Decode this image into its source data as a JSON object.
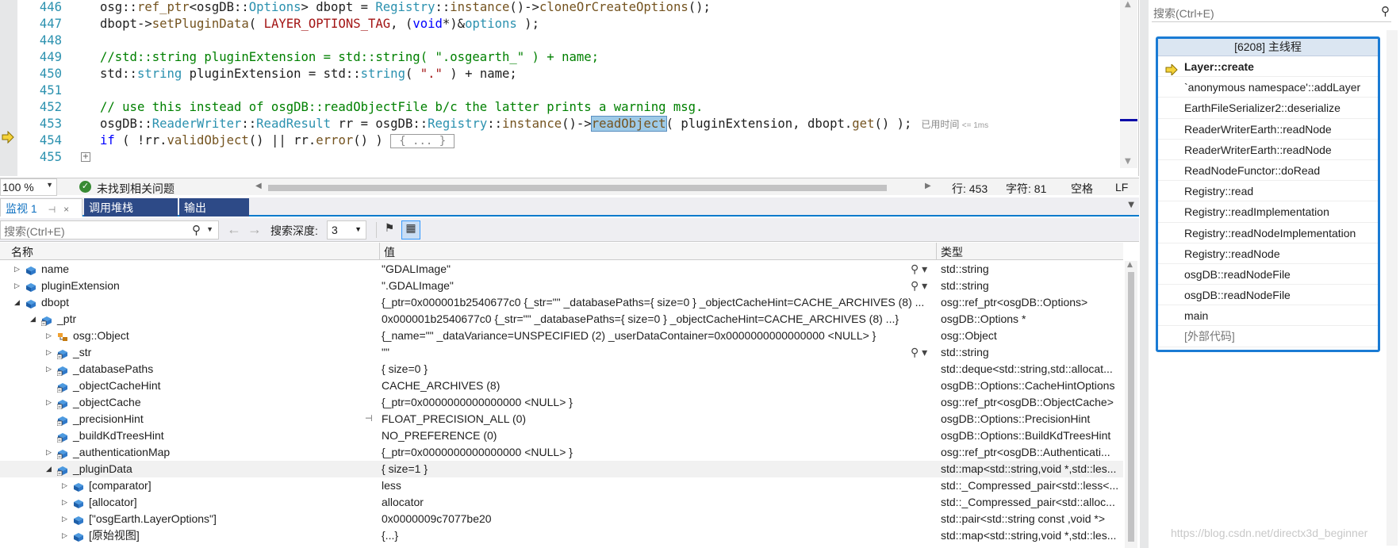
{
  "editor": {
    "lines": [
      {
        "num": "446",
        "tokens": [
          [
            "",
            "osg::"
          ],
          [
            "f",
            "ref_ptr"
          ],
          [
            "",
            "<osgDB::"
          ],
          [
            "t",
            "Options"
          ],
          [
            "",
            "> dbopt = "
          ],
          [
            "t",
            "Registry"
          ],
          [
            "",
            "::"
          ],
          [
            "f",
            "instance"
          ],
          [
            "",
            "()->"
          ],
          [
            "f",
            "cloneOrCreateOptions"
          ],
          [
            "",
            "();"
          ]
        ]
      },
      {
        "num": "447",
        "tokens": [
          [
            "",
            "dbopt->"
          ],
          [
            "f",
            "setPluginData"
          ],
          [
            "",
            "( "
          ],
          [
            "s",
            "LAYER_OPTIONS_TAG"
          ],
          [
            "",
            ", ("
          ],
          [
            "k",
            "void"
          ],
          [
            "",
            "*)&"
          ],
          [
            "t",
            "options"
          ],
          [
            "",
            " );"
          ]
        ]
      },
      {
        "num": "448",
        "tokens": []
      },
      {
        "num": "449",
        "tokens": [
          [
            "c",
            "//std::string pluginExtension = std::string( \".osgearth_\" ) + name;"
          ]
        ]
      },
      {
        "num": "450",
        "tokens": [
          [
            "",
            "std::"
          ],
          [
            "t",
            "string"
          ],
          [
            "",
            " pluginExtension = std::"
          ],
          [
            "t",
            "string"
          ],
          [
            "",
            "( "
          ],
          [
            "s",
            "\".\""
          ],
          [
            "",
            " ) + name;"
          ]
        ]
      },
      {
        "num": "451",
        "tokens": []
      },
      {
        "num": "452",
        "tokens": [
          [
            "c",
            "// use this instead of osgDB::readObjectFile b/c the latter prints a warning msg."
          ]
        ]
      },
      {
        "num": "453",
        "tokens": [
          [
            "",
            "osgDB::"
          ],
          [
            "t",
            "ReaderWriter"
          ],
          [
            "",
            "::"
          ],
          [
            "t",
            "ReadResult"
          ],
          [
            "",
            " rr = osgDB::"
          ],
          [
            "t",
            "Registry"
          ],
          [
            "",
            "::"
          ],
          [
            "f",
            "instance"
          ],
          [
            "",
            "()->"
          ],
          [
            "hl",
            "readObject"
          ],
          [
            "",
            "( pluginExtension, dbopt."
          ],
          [
            "f",
            "get"
          ],
          [
            "",
            "() );"
          ]
        ],
        "elapsed": "已用时间",
        "elapsed_small": "<= 1ms"
      },
      {
        "num": "454",
        "tokens": [
          [
            "k",
            "if"
          ],
          [
            "",
            " ( !rr."
          ],
          [
            "f",
            "validObject"
          ],
          [
            "",
            "() || rr."
          ],
          [
            "f",
            "error"
          ],
          [
            "",
            "() )"
          ]
        ],
        "fold": "{ ... }"
      },
      {
        "num": "455",
        "tokens": []
      }
    ]
  },
  "status": {
    "zoom": "100 %",
    "ok_text": "未找到相关问题",
    "line": "行: 453",
    "char": "字符: 81",
    "ws": "空格",
    "eol": "LF"
  },
  "tabs": [
    "监视 1",
    "调用堆栈",
    "输出"
  ],
  "watch": {
    "search_placeholder": "搜索(Ctrl+E)",
    "depth_label": "搜索深度:",
    "depth_value": "3",
    "col_name": "名称",
    "col_value": "值",
    "col_type": "类型",
    "rows": [
      {
        "indent": 0,
        "exp": "▷",
        "icon": "field-icon",
        "name": "name",
        "value": "\"GDALImage\"",
        "type": "std::string",
        "mag": true
      },
      {
        "indent": 0,
        "exp": "▷",
        "icon": "field-icon",
        "name": "pluginExtension",
        "value": "\".GDALImage\"",
        "type": "std::string",
        "mag": true
      },
      {
        "indent": 0,
        "exp": "◢",
        "icon": "field-icon",
        "name": "dbopt",
        "value": "{_ptr=0x000001b2540677c0 {_str=\"\" _databasePaths={ size=0 } _objectCacheHint=CACHE_ARCHIVES (8) ...",
        "type": "osg::ref_ptr<osgDB::Options>"
      },
      {
        "indent": 1,
        "exp": "◢",
        "icon": "protected-field-icon",
        "name": "_ptr",
        "value": "0x000001b2540677c0 {_str=\"\" _databasePaths={ size=0 } _objectCacheHint=CACHE_ARCHIVES (8) ...}",
        "type": "osgDB::Options *"
      },
      {
        "indent": 2,
        "exp": "▷",
        "icon": "base-class-icon",
        "name": "osg::Object",
        "value": "{_name=\"\" _dataVariance=UNSPECIFIED (2) _userDataContainer=0x0000000000000000 <NULL> }",
        "type": "osg::Object"
      },
      {
        "indent": 2,
        "exp": "▷",
        "icon": "protected-field-icon",
        "name": "_str",
        "value": "\"\"",
        "type": "std::string",
        "mag": true
      },
      {
        "indent": 2,
        "exp": "▷",
        "icon": "protected-field-icon",
        "name": "_databasePaths",
        "value": "{ size=0 }",
        "type": "std::deque<std::string,std::allocat..."
      },
      {
        "indent": 2,
        "exp": "",
        "icon": "protected-field-icon",
        "name": "_objectCacheHint",
        "value": "CACHE_ARCHIVES (8)",
        "type": "osgDB::Options::CacheHintOptions"
      },
      {
        "indent": 2,
        "exp": "▷",
        "icon": "protected-field-icon",
        "name": "_objectCache",
        "value": "{_ptr=0x0000000000000000 <NULL> }",
        "type": "osg::ref_ptr<osgDB::ObjectCache>"
      },
      {
        "indent": 2,
        "exp": "",
        "icon": "protected-field-icon",
        "name": "_precisionHint",
        "value": "FLOAT_PRECISION_ALL (0)",
        "type": "osgDB::Options::PrecisionHint",
        "pin": true
      },
      {
        "indent": 2,
        "exp": "",
        "icon": "protected-field-icon",
        "name": "_buildKdTreesHint",
        "value": "NO_PREFERENCE (0)",
        "type": "osgDB::Options::BuildKdTreesHint"
      },
      {
        "indent": 2,
        "exp": "▷",
        "icon": "protected-field-icon",
        "name": "_authenticationMap",
        "value": "{_ptr=0x0000000000000000 <NULL> }",
        "type": "osg::ref_ptr<osgDB::Authenticati..."
      },
      {
        "indent": 2,
        "exp": "◢",
        "icon": "protected-field-icon",
        "name": "_pluginData",
        "value": "{ size=1 }",
        "type": "std::map<std::string,void *,std::les...",
        "sel": true
      },
      {
        "indent": 3,
        "exp": "▷",
        "icon": "field-icon",
        "name": "[comparator]",
        "value": "less",
        "type": "std::_Compressed_pair<std::less<..."
      },
      {
        "indent": 3,
        "exp": "▷",
        "icon": "field-icon",
        "name": "[allocator]",
        "value": "allocator",
        "type": "std::_Compressed_pair<std::alloc..."
      },
      {
        "indent": 3,
        "exp": "▷",
        "icon": "field-icon",
        "name": "[\"osgEarth.LayerOptions\"]",
        "value": "0x0000009c7077be20",
        "type": "std::pair<std::string const ,void *>"
      },
      {
        "indent": 3,
        "exp": "▷",
        "icon": "field-icon",
        "name": "[原始视图]",
        "value": "{...}",
        "type": "std::map<std::string,void *,std::les..."
      }
    ]
  },
  "callstack": {
    "search_placeholder": "搜索(Ctrl+E)",
    "thread": "[6208] 主线程",
    "frames": [
      "Layer::create",
      "`anonymous namespace'::addLayer",
      "EarthFileSerializer2::deserialize",
      "ReaderWriterEarth::readNode",
      "ReaderWriterEarth::readNode",
      "ReadNodeFunctor::doRead",
      "Registry::read",
      "Registry::readImplementation",
      "Registry::readNodeImplementation",
      "Registry::readNode",
      "osgDB::readNodeFile",
      "osgDB::readNodeFile",
      "main",
      "[外部代码]"
    ]
  },
  "watermark": "https://blog.csdn.net/directx3d_beginner",
  "colors": {
    "accent": "#007acc",
    "tab_inactive": "#2d4a87",
    "frame_border": "#1a7bd4",
    "comment": "#008000",
    "keyword": "#0000ff",
    "type": "#2b91af"
  }
}
